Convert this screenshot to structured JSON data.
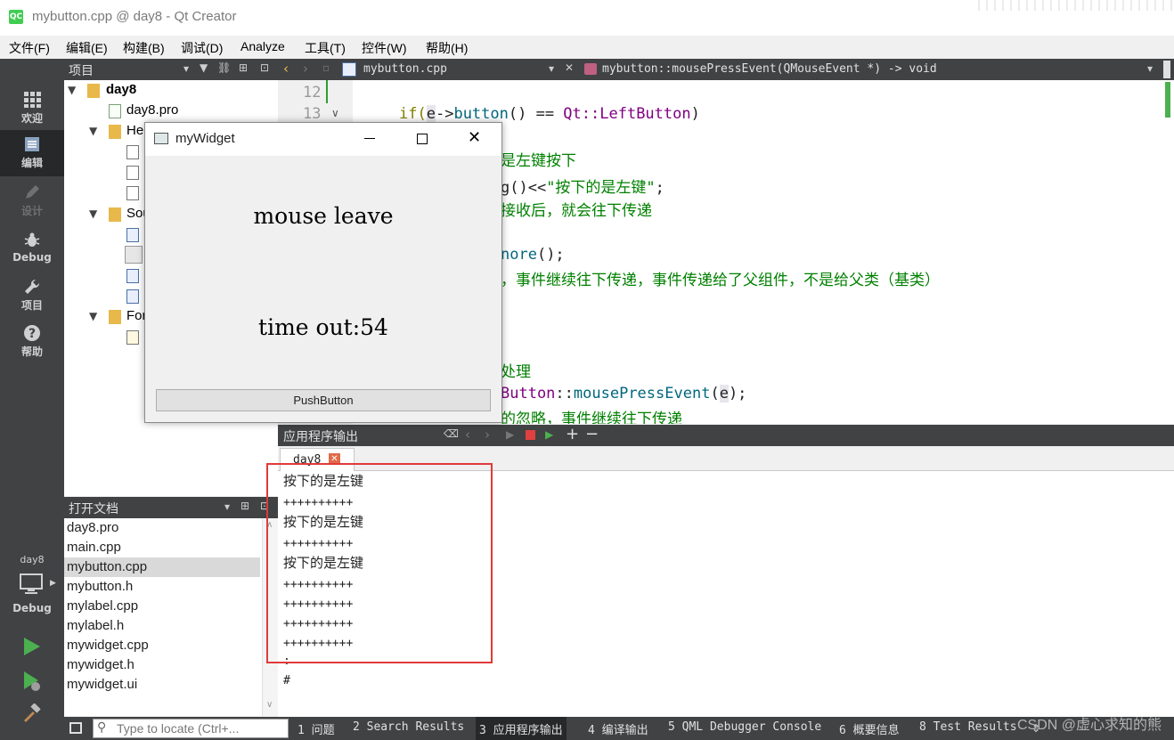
{
  "window": {
    "title": "mybutton.cpp @ day8 - Qt Creator",
    "logo": "QC"
  },
  "menu": [
    "文件(F)",
    "编辑(E)",
    "构建(B)",
    "调试(D)",
    "Analyze",
    "工具(T)",
    "控件(W)",
    "帮助(H)"
  ],
  "modes": {
    "welcome": "欢迎",
    "edit": "编辑",
    "design": "设计",
    "debug": "Debug",
    "projects": "项目",
    "help": "帮助",
    "kit_name": "day8",
    "kit_mode": "Debug"
  },
  "projects": {
    "header": "项目",
    "tree": {
      "root": "day8",
      "pro": "day8.pro",
      "headers": "He",
      "sources": "Sou",
      "forms": "For"
    }
  },
  "open_docs": {
    "header": "打开文档",
    "items": [
      "day8.pro",
      "main.cpp",
      "mybutton.cpp",
      "mybutton.h",
      "mylabel.cpp",
      "mylabel.h",
      "mywidget.cpp",
      "mywidget.h",
      "mywidget.ui"
    ],
    "selected_index": 2
  },
  "editor": {
    "file_tab": "mybutton.cpp",
    "symbol": "mybutton::mousePressEvent(QMouseEvent *) -> void",
    "line_numbers": [
      "12",
      "13"
    ],
    "lines": {
      "l13_kw": "if(",
      "l13_var": "e",
      "l13_arrow": "->",
      "l13_fn": "button",
      "l13_rest": "() == ",
      "l13_ns": "Qt::",
      "l13_enum": "LeftButton",
      "l13_end": ")",
      "c1": "是左键按下",
      "c2_pre": "g()<<",
      "c2_str": "\"按下的是左键\"",
      "c2_end": ";",
      "c3": "接收后，就会往下传递",
      "c4_fn": "nore",
      "c4_end": "();",
      "c5": "，事件继续往下传递，事件传递给了父组件，不是给父类（基类）",
      "c6": "处理",
      "c7_cls": "Button",
      "c7_sep": "::",
      "c7_fn": "mousePressEvent",
      "c7_open": "(",
      "c7_arg": "e",
      "c7_close": ");",
      "c8": "的忽略，事件继续往下传递"
    }
  },
  "output": {
    "header": "应用程序输出",
    "tab": "day8",
    "lines": [
      "按下的是左键",
      "++++++++++",
      "按下的是左键",
      "++++++++++",
      "按下的是左键",
      "++++++++++",
      "++++++++++",
      "++++++++++",
      "++++++++++",
      ":",
      "#"
    ]
  },
  "status": {
    "locator_placeholder": "Type to locate (Ctrl+...",
    "tabs": [
      "1 问题",
      "2 Search Results",
      "3 应用程序输出",
      "4 编译输出",
      "5 QML Debugger Console",
      "6 概要信息",
      "8 Test Results"
    ]
  },
  "widget_window": {
    "title": "myWidget",
    "label1": "mouse leave",
    "label2": "time out:54",
    "button": "PushButton"
  },
  "watermark": "CSDN @虚心求知的熊"
}
